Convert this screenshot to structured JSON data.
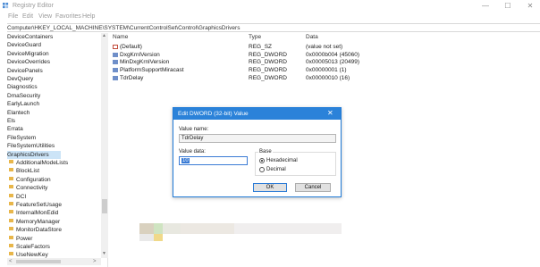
{
  "window": {
    "title": "Registry Editor",
    "minimize": "—",
    "maximize": "☐",
    "close": "✕"
  },
  "menu": [
    "File",
    "Edit",
    "View",
    "Favorites",
    "Help"
  ],
  "address": "Computer\\HKEY_LOCAL_MACHINE\\SYSTEM\\CurrentControlSet\\Control\\GraphicsDrivers",
  "tree": {
    "items": [
      {
        "label": "DeviceContainers",
        "folder": false,
        "selected": false
      },
      {
        "label": "DeviceGuard",
        "folder": false,
        "selected": false
      },
      {
        "label": "DeviceMigration",
        "folder": false,
        "selected": false
      },
      {
        "label": "DeviceOverrides",
        "folder": false,
        "selected": false
      },
      {
        "label": "DevicePanels",
        "folder": false,
        "selected": false
      },
      {
        "label": "DevQuery",
        "folder": false,
        "selected": false
      },
      {
        "label": "Diagnostics",
        "folder": false,
        "selected": false
      },
      {
        "label": "DmaSecurity",
        "folder": false,
        "selected": false
      },
      {
        "label": "EarlyLaunch",
        "folder": false,
        "selected": false
      },
      {
        "label": "Elantech",
        "folder": false,
        "selected": false
      },
      {
        "label": "Els",
        "folder": false,
        "selected": false
      },
      {
        "label": "Errata",
        "folder": false,
        "selected": false
      },
      {
        "label": "FileSystem",
        "folder": false,
        "selected": false
      },
      {
        "label": "FileSystemUtilities",
        "folder": false,
        "selected": false
      },
      {
        "label": "GraphicsDrivers",
        "folder": false,
        "selected": true
      },
      {
        "label": "AdditionalModeLists",
        "folder": true,
        "selected": false
      },
      {
        "label": "BlockList",
        "folder": true,
        "selected": false
      },
      {
        "label": "Configuration",
        "folder": true,
        "selected": false
      },
      {
        "label": "Connectivity",
        "folder": true,
        "selected": false
      },
      {
        "label": "DCI",
        "folder": true,
        "selected": false
      },
      {
        "label": "FeatureSetUsage",
        "folder": true,
        "selected": false
      },
      {
        "label": "InternalMonEdid",
        "folder": true,
        "selected": false
      },
      {
        "label": "MemoryManager",
        "folder": true,
        "selected": false
      },
      {
        "label": "MonitorDataStore",
        "folder": true,
        "selected": false
      },
      {
        "label": "Power",
        "folder": true,
        "selected": false
      },
      {
        "label": "ScaleFactors",
        "folder": true,
        "selected": false
      },
      {
        "label": "UseNewKey",
        "folder": true,
        "selected": false
      }
    ],
    "scroll_up": "▲",
    "scroll_down": "▼",
    "scroll_left": "<",
    "scroll_right": ">"
  },
  "values": {
    "headers": {
      "name": "Name",
      "type": "Type",
      "data": "Data"
    },
    "rows": [
      {
        "name": "(Default)",
        "type": "REG_SZ",
        "data": "(value not set)",
        "kind": "sz"
      },
      {
        "name": "DxgKrnlVersion",
        "type": "REG_DWORD",
        "data": "0x0000b004 (45060)",
        "kind": "dword"
      },
      {
        "name": "MinDxgKrnlVersion",
        "type": "REG_DWORD",
        "data": "0x00005013 (20499)",
        "kind": "dword"
      },
      {
        "name": "PlatformSupportMiracast",
        "type": "REG_DWORD",
        "data": "0x00000001 (1)",
        "kind": "dword"
      },
      {
        "name": "TdrDelay",
        "type": "REG_DWORD",
        "data": "0x00000010 (16)",
        "kind": "dword"
      }
    ]
  },
  "dialog": {
    "title": "Edit DWORD (32-bit) Value",
    "close": "✕",
    "value_name_label": "Value name:",
    "value_name": "TdrDelay",
    "value_data_label": "Value data:",
    "value_data": "10",
    "base_label": "Base",
    "hex_label": "Hexadecimal",
    "dec_label": "Decimal",
    "base_selected": "Hexadecimal",
    "ok_label": "OK",
    "cancel_label": "Cancel"
  },
  "colors": {
    "dialog_title_bg": "#2b82d9",
    "selection_bg": "#cce4f7",
    "folder": "#e8b64a"
  }
}
